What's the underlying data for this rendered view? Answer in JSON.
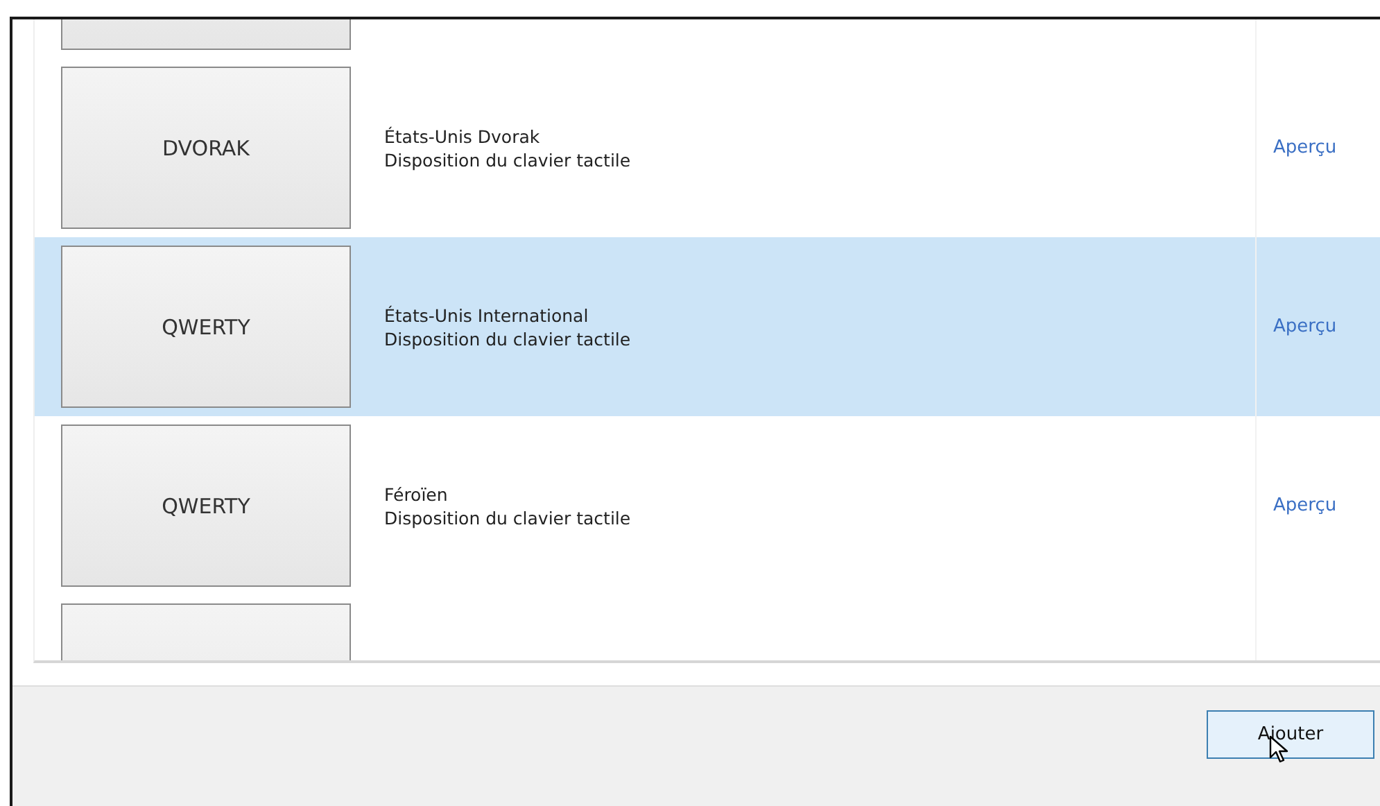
{
  "layouts": [
    {
      "selected": false
    },
    {
      "key": "DVORAK",
      "name": "États-Unis Dvorak",
      "description": "Disposition du clavier tactile",
      "preview": "Aperçu",
      "selected": false
    },
    {
      "key": "QWERTY",
      "name": "États-Unis International",
      "description": "Disposition du clavier tactile",
      "preview": "Aperçu",
      "selected": true
    },
    {
      "key": "QWERTY",
      "name": "Féroïen",
      "description": "Disposition du clavier tactile",
      "preview": "Aperçu",
      "selected": false
    },
    {
      "selected": false
    }
  ],
  "buttons": [
    {
      "label": "Ajouter"
    }
  ]
}
